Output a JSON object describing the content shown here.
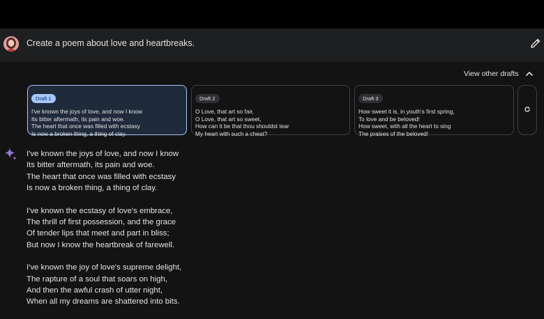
{
  "prompt": {
    "text": "Create a poem about love and heartbreaks.",
    "avatar_icon": "user-avatar",
    "edit_icon": "pencil-icon"
  },
  "drafts": {
    "toggle_label": "View other drafts",
    "toggle_icon": "chevron-up-icon",
    "items": [
      {
        "label": "Draft 1",
        "selected": true,
        "lines": [
          "I've known the joys of love, and now I know",
          "Its bitter aftermath, its pain and woe.",
          "The heart that once was filled with ecstasy",
          "Is now a broken thing, a thing of clay."
        ]
      },
      {
        "label": "Draft 2",
        "selected": false,
        "lines": [
          "O Love, that art so fair,",
          "O Love, that art so sweet,",
          "How can it be that thou shouldst tear",
          "My heart with such a cheat?"
        ]
      },
      {
        "label": "Draft 3",
        "selected": false,
        "lines": [
          "How sweet it is, in youth's first spring,",
          "To love and be beloved!",
          "How sweet, with all the heart to sing",
          "The praises of the beloved!"
        ]
      }
    ],
    "regenerate_icon": "refresh-icon"
  },
  "response": {
    "icon": "sparkle-icon",
    "stanzas": [
      [
        "I've known the joys of love, and now I know",
        "Its bitter aftermath, its pain and woe.",
        "The heart that once was filled with ecstasy",
        "Is now a broken thing, a thing of clay."
      ],
      [
        "I've known the ecstasy of love's embrace,",
        "The thrill of first possession, and the grace",
        "Of tender lips that meet and part in bliss;",
        "But now I know the heartbreak of farewell."
      ],
      [
        "I've known the joy of love's supreme delight,",
        "The rapture of a soul that soars on high,",
        "And then the awful crash of utter night,",
        "When all my dreams are shattered into bits."
      ]
    ]
  },
  "colors": {
    "background": "#131314",
    "prompt_bar": "#1e1f20",
    "top_bar": "#000000",
    "selected_draft_bg": "#1f2a3b",
    "selected_draft_border": "#a8c7fa",
    "text": "#e3e3e3"
  }
}
